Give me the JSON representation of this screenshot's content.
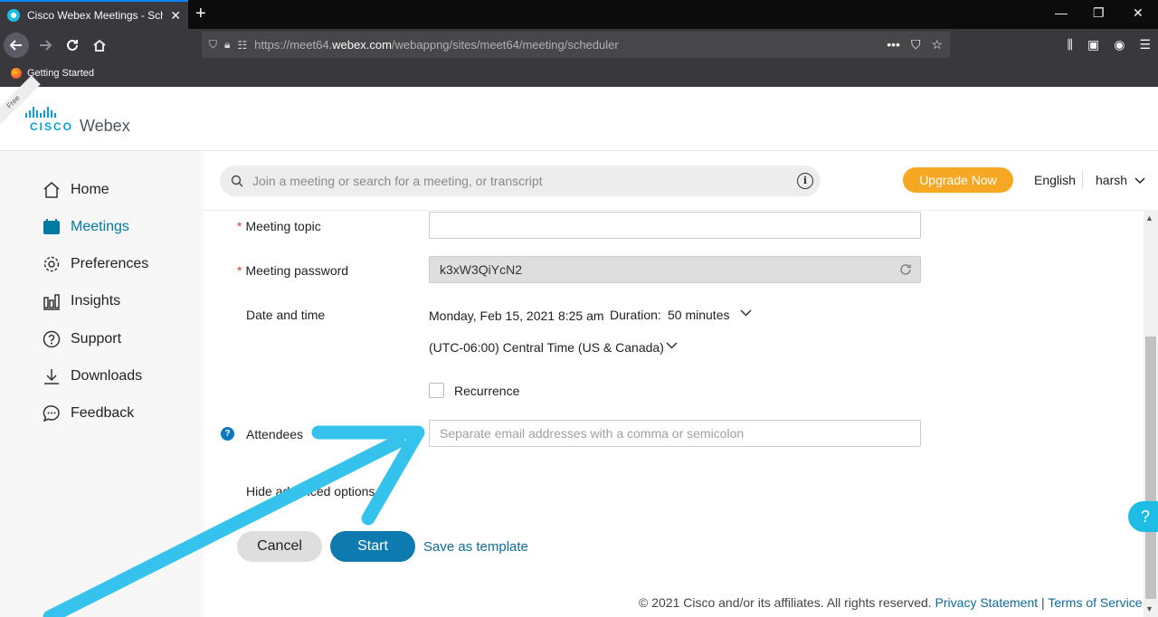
{
  "browser": {
    "tab_title": "Cisco Webex Meetings - Sched",
    "tab_close": "✕",
    "new_tab": "+",
    "url_prefix": "https://meet64.",
    "url_domain": "webex.com",
    "url_path": "/webappng/sites/meet64/meeting/scheduler",
    "bookmark": "Getting Started",
    "window_controls": [
      "—",
      "❐",
      "✕"
    ]
  },
  "header": {
    "free_ribbon": "Free",
    "logo_cisco": "CISCO",
    "logo_webex": "Webex"
  },
  "sidebar": {
    "items": [
      {
        "label": "Home",
        "icon": "home-icon"
      },
      {
        "label": "Meetings",
        "icon": "calendar-icon"
      },
      {
        "label": "Preferences",
        "icon": "gear-icon"
      },
      {
        "label": "Insights",
        "icon": "bar-chart-icon"
      },
      {
        "label": "Support",
        "icon": "help-circle-icon"
      },
      {
        "label": "Downloads",
        "icon": "download-icon"
      },
      {
        "label": "Feedback",
        "icon": "chat-bubble-icon"
      }
    ],
    "active_color": "#007aa3"
  },
  "topbar": {
    "search_placeholder": "Join a meeting or search for a meeting, or transcript",
    "info": "i",
    "upgrade": "Upgrade Now",
    "language": "English",
    "user": "harsh",
    "accent": "#f7a823"
  },
  "form": {
    "required_mark": "*",
    "topic_label": "Meeting topic",
    "topic_value": "",
    "password_label": "Meeting password",
    "password_value": "k3xW3QiYcN2",
    "datetime_label": "Date and time",
    "datetime_value": "Monday, Feb 15, 2021 8:25 am",
    "duration_label": "Duration:",
    "duration_value": "50 minutes",
    "timezone": "(UTC-06:00) Central Time (US & Canada)",
    "recurrence": "Recurrence",
    "attendees_label": "Attendees",
    "attendees_placeholder": "Separate email addresses with a comma or semicolon",
    "help_mark": "?",
    "advanced": "Hide advanced options",
    "cancel": "Cancel",
    "start": "Start",
    "save_template": "Save as template"
  },
  "footer": {
    "copyright": "© 2021 Cisco and/or its affiliates. All rights reserved.",
    "privacy": "Privacy Statement",
    "divider": "|",
    "terms": "Terms of Service"
  },
  "help_float": "?",
  "annotation_color": "#35c3ee"
}
